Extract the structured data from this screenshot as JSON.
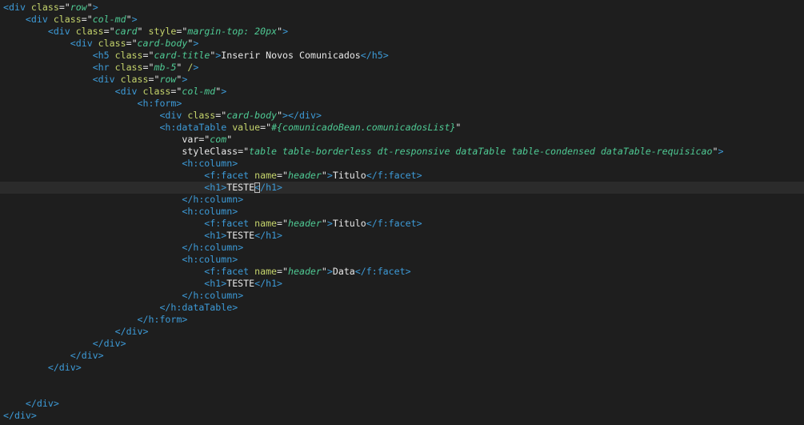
{
  "editor": {
    "current_line": 15,
    "cursor_column": 45,
    "colors": {
      "background": "#1e1e1e",
      "tag": "#3d9bd8",
      "attribute": "#c5d46c",
      "string": "#4fca94",
      "text": "#e8e8e8"
    },
    "lines": [
      "<div class=\"row\">",
      "    <div class=\"col-md\">",
      "        <div class=\"card\" style=\"margin-top: 20px\">",
      "            <div class=\"card-body\">",
      "                <h5 class=\"card-title\">Inserir Novos Comunicados</h5>",
      "                <hr class=\"mb-5\" />",
      "                <div class=\"row\">",
      "                    <div class=\"col-md\">",
      "                        <h:form>",
      "                            <div class=\"card-body\"></div>",
      "                            <h:dataTable value=\"#{comunicadoBean.comunicadosList}\"",
      "                                var=\"com\"",
      "                                styleClass=\"table table-borderless dt-responsive dataTable table-condensed dataTable-requisicao\">",
      "                                <h:column>",
      "                                    <f:facet name=\"header\">Titulo</f:facet>",
      "                                    <h1>TESTE</h1>",
      "                                </h:column>",
      "                                <h:column>",
      "                                    <f:facet name=\"header\">Titulo</f:facet>",
      "                                    <h1>TESTE</h1>",
      "                                </h:column>",
      "                                <h:column>",
      "                                    <f:facet name=\"header\">Data</f:facet>",
      "                                    <h1>TESTE</h1>",
      "                                </h:column>",
      "                            </h:dataTable>",
      "                        </h:form>",
      "                    </div>",
      "                </div>",
      "            </div>",
      "        </div>",
      "",
      "",
      "    </div>",
      "</div>"
    ]
  }
}
